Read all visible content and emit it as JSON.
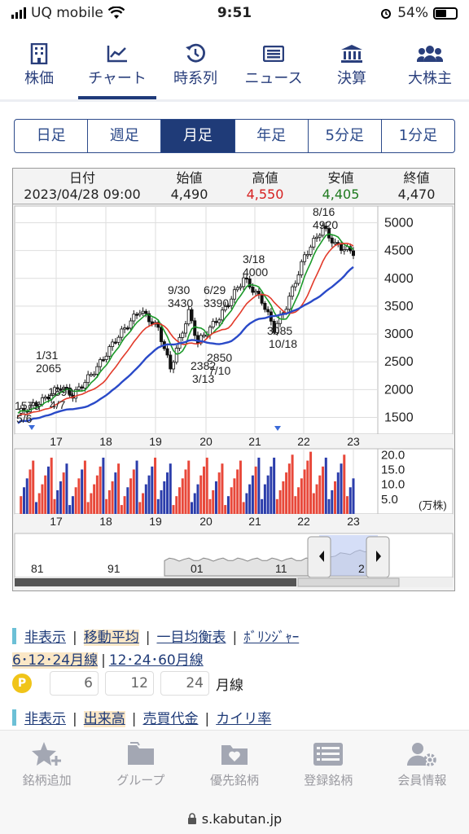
{
  "status": {
    "carrier": "UQ mobile",
    "time": "9:51",
    "battery": "54%"
  },
  "topnav": [
    {
      "label": "株価",
      "icon": "building-icon"
    },
    {
      "label": "チャート",
      "icon": "chart-icon",
      "active": true
    },
    {
      "label": "時系列",
      "icon": "history-icon"
    },
    {
      "label": "ニュース",
      "icon": "news-icon"
    },
    {
      "label": "決算",
      "icon": "bank-icon"
    },
    {
      "label": "大株主",
      "icon": "users-icon"
    }
  ],
  "tabs": [
    {
      "label": "日足"
    },
    {
      "label": "週足"
    },
    {
      "label": "月足",
      "active": true
    },
    {
      "label": "年足"
    },
    {
      "label": "5分足"
    },
    {
      "label": "1分足"
    }
  ],
  "ohlc": {
    "date_label": "日付",
    "date": "2023/04/28 09:00",
    "open_label": "始値",
    "open": "4,490",
    "high_label": "高値",
    "high": "4,550",
    "low_label": "安値",
    "low": "4,405",
    "close_label": "終値",
    "close": "4,470"
  },
  "chart_data": {
    "type": "candlestick",
    "y_ticks": [
      "5000",
      "4500",
      "4000",
      "3500",
      "3000",
      "2500",
      "2000",
      "1500"
    ],
    "ylim": [
      1200,
      5300
    ],
    "x_ticks": [
      "17",
      "18",
      "19",
      "20",
      "21",
      "22",
      "23"
    ],
    "annotations": [
      {
        "date": "5/6",
        "value": "1575"
      },
      {
        "date": "1/31",
        "value": "2065"
      },
      {
        "date": "4/7",
        "value": "1890"
      },
      {
        "date": "9/30",
        "value": "3430"
      },
      {
        "date": "3/13",
        "value": "2382"
      },
      {
        "date": "6/29",
        "value": "3390"
      },
      {
        "date": "7/10",
        "value": "2850"
      },
      {
        "date": "3/18",
        "value": "4000"
      },
      {
        "date": "10/18",
        "value": "3085"
      },
      {
        "date": "8/16",
        "value": "4920"
      }
    ],
    "volume_ticks": [
      "20.0",
      "15.0",
      "10.0",
      "5.0"
    ],
    "volume_unit": "(万株)",
    "navigator_labels": [
      "81",
      "91",
      "01",
      "11",
      "2"
    ],
    "colors": {
      "up": "#1a1a1a",
      "down": "#1a1a1a",
      "ma6": "#1c9a2a",
      "ma12": "#e23a2a",
      "ma24": "#2a4ac8",
      "vol_red": "#e8483a",
      "vol_blue": "#2b3dab"
    }
  },
  "links1": {
    "hide": "非表示",
    "ma": "移動平均",
    "ichimoku": "一目均衡表",
    "bollinger": "ﾎﾞﾘﾝｼﾞｬｰ"
  },
  "links2": {
    "ma_a": "6･12･24月線",
    "ma_b": "12･24･60月線"
  },
  "ma_inputs": {
    "a": "6",
    "b": "12",
    "c": "24",
    "suffix": "月線"
  },
  "links3": {
    "hide": "非表示",
    "volume": "出来高",
    "turnover": "売買代金",
    "deviation": "カイリ率"
  },
  "bottom": [
    {
      "label": "銘柄追加",
      "icon": "star-plus-icon"
    },
    {
      "label": "グループ",
      "icon": "folder-icon"
    },
    {
      "label": "優先銘柄",
      "icon": "heart-folder-icon"
    },
    {
      "label": "登録銘柄",
      "icon": "list-icon"
    },
    {
      "label": "会員情報",
      "icon": "user-gear-icon"
    }
  ],
  "url": "s.kabutan.jp"
}
